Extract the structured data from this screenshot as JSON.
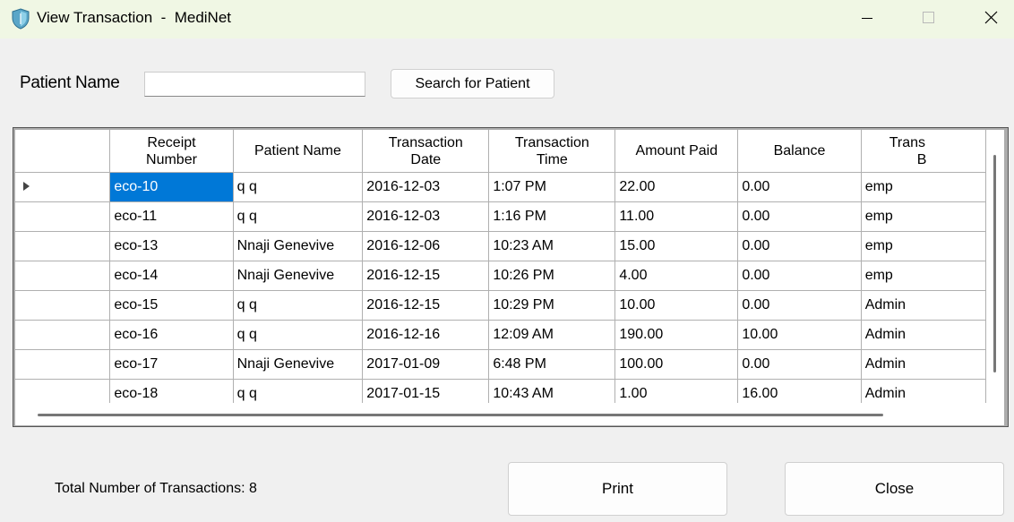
{
  "window": {
    "title": "View Transaction  -  MediNet",
    "controls": [
      "minimize-icon",
      "maximize-icon",
      "close-icon"
    ]
  },
  "search": {
    "label": "Patient Name",
    "value": "",
    "placeholder": "",
    "button_label": "Search for Patient"
  },
  "table": {
    "columns": [
      {
        "line1": "Receipt",
        "line2": "Number"
      },
      {
        "line1": "Patient Name",
        "line2": ""
      },
      {
        "line1": "Transaction",
        "line2": "Date"
      },
      {
        "line1": "Transaction",
        "line2": "Time"
      },
      {
        "line1": "Amount Paid",
        "line2": ""
      },
      {
        "line1": "Balance",
        "line2": ""
      },
      {
        "line1": "Trans",
        "line2": "B"
      }
    ],
    "rows": [
      [
        "eco-10",
        "q q",
        "2016-12-03",
        "1:07 PM",
        "22.00",
        "0.00",
        "emp"
      ],
      [
        "eco-11",
        "q q",
        "2016-12-03",
        "1:16 PM",
        "11.00",
        "0.00",
        "emp"
      ],
      [
        "eco-13",
        "Nnaji Genevive",
        "2016-12-06",
        "10:23 AM",
        "15.00",
        "0.00",
        "emp"
      ],
      [
        "eco-14",
        "Nnaji Genevive",
        "2016-12-15",
        "10:26 PM",
        "4.00",
        "0.00",
        "emp"
      ],
      [
        "eco-15",
        "q q",
        "2016-12-15",
        "10:29 PM",
        "10.00",
        "0.00",
        "Admin"
      ],
      [
        "eco-16",
        "q q",
        "2016-12-16",
        "12:09 AM",
        "190.00",
        "10.00",
        "Admin"
      ],
      [
        "eco-17",
        "Nnaji Genevive",
        "2017-01-09",
        "6:48 PM",
        "100.00",
        "0.00",
        "Admin"
      ],
      [
        "eco-18",
        "q q",
        "2017-01-15",
        "10:43 AM",
        "1.00",
        "16.00",
        "Admin"
      ]
    ],
    "selected_row": 0,
    "current_row_icon": "row-pointer-arrow-icon",
    "selection_color": "#0078d7"
  },
  "footer": {
    "total_label": "Total Number of Transactions: 8",
    "print_label": "Print",
    "close_label": "Close"
  },
  "colors": {
    "titlebar": "#f0f7e4",
    "window_bg": "#f0f0f0",
    "selection": "#0078d7"
  }
}
